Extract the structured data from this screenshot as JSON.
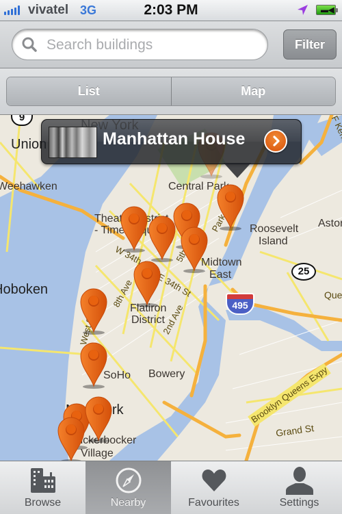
{
  "status_bar": {
    "carrier": "vivatel",
    "network": "3G",
    "time": "2:03 PM",
    "signal_bars": 5,
    "location_icon": "location-arrow-icon",
    "battery_icon": "battery-charging-icon"
  },
  "search": {
    "placeholder": "Search buildings",
    "value": "",
    "icon": "search-icon",
    "filter_label": "Filter"
  },
  "view_toggle": {
    "items": [
      {
        "label": "List"
      },
      {
        "label": "Map"
      }
    ]
  },
  "map": {
    "callout": {
      "title": "Manhattan House",
      "thumbnail": "building-photo",
      "action_icon": "chevron-right-icon"
    },
    "labels": {
      "new_york_top": "New York",
      "union": "Union",
      "weehawken": "Weehawken",
      "central_park": "Central Park",
      "theater_district": "Theater District",
      "times_square": "- Times Square",
      "astoria": "Astoria",
      "roosevelt_island_1": "Roosevelt",
      "roosevelt_island_2": "Island",
      "midtown_east_1": "Midtown",
      "midtown_east_2": "East",
      "hoboken": "Hoboken",
      "w34": "W 34th St",
      "e34": "E 34th St",
      "eighth_ave": "8th Ave",
      "fifth_ave": "5th Ave",
      "park_ave": "Park Ave",
      "second_ave": "2nd Ave",
      "west_st": "West St",
      "flatiron_1": "Flatiron",
      "flatiron_2": "District",
      "soho": "SoHo",
      "bowery": "Bowery",
      "new_york": "New York",
      "knickerbocker_1": "Knickerbocker",
      "knickerbocker_2": "Village",
      "queens": "Queens",
      "bqe": "Brooklyn Queens Expy",
      "grand_st": "Grand St",
      "fdr": "F Kenn",
      "route_9": "9",
      "route_25": "25",
      "interstate_495": "495"
    },
    "pin_count": 12,
    "pin_color": "#e8620f"
  },
  "tab_bar": {
    "items": [
      {
        "label": "Browse",
        "icon": "buildings-icon",
        "active": false
      },
      {
        "label": "Nearby",
        "icon": "compass-icon",
        "active": true
      },
      {
        "label": "Favourites",
        "icon": "heart-icon",
        "active": false
      },
      {
        "label": "Settings",
        "icon": "person-icon",
        "active": false
      }
    ]
  }
}
